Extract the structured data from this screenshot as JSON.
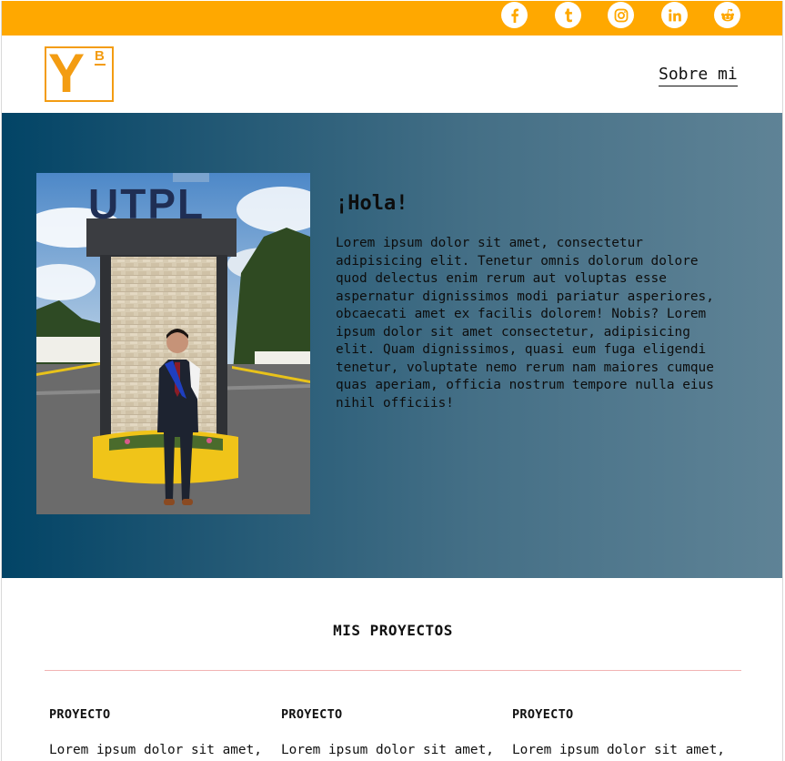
{
  "topbar": {
    "social": [
      {
        "icon": "facebook-icon"
      },
      {
        "icon": "tumblr-icon"
      },
      {
        "icon": "instagram-icon"
      },
      {
        "icon": "linkedin-icon"
      },
      {
        "icon": "reddit-icon"
      }
    ]
  },
  "header": {
    "logo": {
      "letter": "Y",
      "superscript": "B"
    },
    "nav_link": "Sobre mi"
  },
  "hero": {
    "sign_text": "UTPL",
    "greeting": "¡Hola!",
    "paragraph": "Lorem ipsum dolor sit amet, consectetur adipisicing elit. Tenetur omnis dolorum dolore quod delectus enim rerum aut voluptas esse aspernatur dignissimos modi pariatur asperiores, obcaecati amet ex facilis dolorem! Nobis? Lorem ipsum dolor sit amet consectetur, adipisicing elit. Quam dignissimos, quasi eum fuga eligendi tenetur, voluptate nemo rerum nam maiores cumque quas aperiam, officia nostrum tempore nulla eius nihil officiis!"
  },
  "projects": {
    "title": "MIS PROYECTOS",
    "items": [
      {
        "title": "PROYECTO",
        "text": "Lorem ipsum dolor sit amet,"
      },
      {
        "title": "PROYECTO",
        "text": "Lorem ipsum dolor sit amet,"
      },
      {
        "title": "PROYECTO",
        "text": "Lorem ipsum dolor sit amet,"
      }
    ]
  },
  "colors": {
    "accent": "#ffa800",
    "logo": "#f39c12",
    "hero_start": "#024466",
    "hero_end": "#5f8396",
    "divider": "#f2b3b3"
  }
}
